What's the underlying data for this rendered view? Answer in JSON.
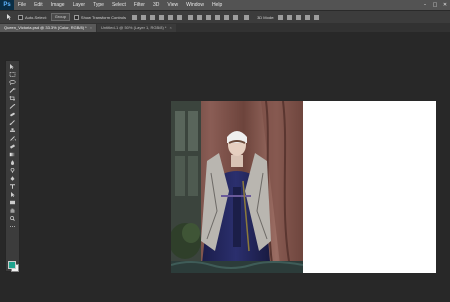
{
  "app": {
    "logo": "Ps"
  },
  "menu": [
    "File",
    "Edit",
    "Image",
    "Layer",
    "Type",
    "Select",
    "Filter",
    "3D",
    "View",
    "Window",
    "Help"
  ],
  "window_controls": {
    "minimize": "–",
    "maximize": "□",
    "close": "✕"
  },
  "options": {
    "auto_select_label": "Auto-Select:",
    "auto_select_value": "Group",
    "transform_label": "Show Transform Controls",
    "mode_3d": "3D Mode:"
  },
  "tabs": [
    {
      "label": "Queen_Victoria.psd @ 33.3% (Color, RGB/8) *",
      "active": true
    },
    {
      "label": "Untitled-1 @ 50% (Layer 1, RGB/8) *",
      "active": false
    }
  ],
  "tools": [
    "move",
    "marquee",
    "lasso",
    "quick-select",
    "crop",
    "eyedropper",
    "healing",
    "brush",
    "clone",
    "history-brush",
    "eraser",
    "gradient",
    "blur",
    "dodge",
    "pen",
    "type",
    "path-select",
    "shape",
    "hand",
    "zoom"
  ],
  "colors": {
    "foreground": "#1fa38e",
    "background": "#f4f4f4",
    "accent": "#0a2e45"
  }
}
